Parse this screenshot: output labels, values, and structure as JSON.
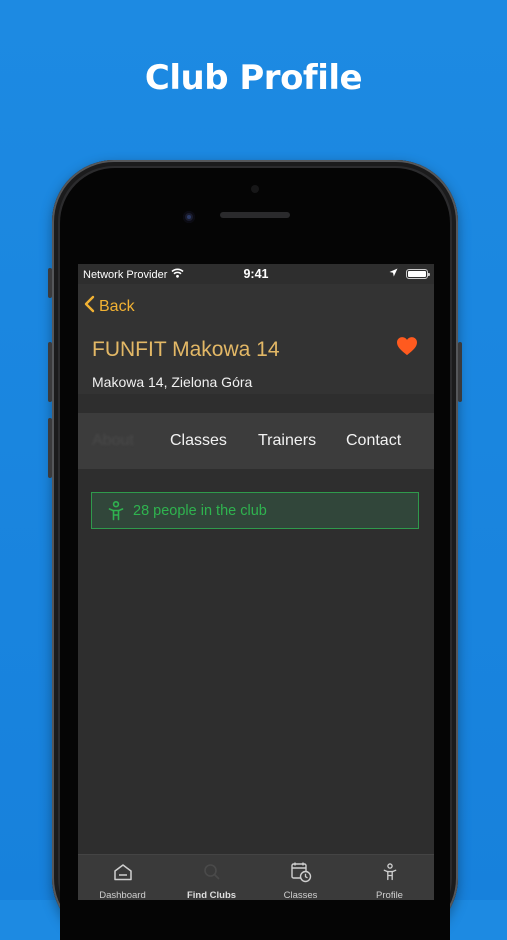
{
  "headline": "Club Profile",
  "status_bar": {
    "carrier": "Network Provider",
    "time": "9:41"
  },
  "nav": {
    "back_label": "Back"
  },
  "club": {
    "name": "FUNFIT Makowa 14",
    "address": "Makowa 14, Zielona Góra",
    "favorite": true
  },
  "tabs": [
    {
      "label": "About",
      "active": true
    },
    {
      "label": "Classes",
      "active": false
    },
    {
      "label": "Trainers",
      "active": false
    },
    {
      "label": "Contact",
      "active": false
    }
  ],
  "occupancy": {
    "text": "28 people in the club"
  },
  "tab_bar": {
    "items": [
      {
        "label": "Dashboard",
        "icon": "home-icon"
      },
      {
        "label": "Find Clubs",
        "icon": "search-icon",
        "active": true
      },
      {
        "label": "Classes",
        "icon": "calendar-clock-icon"
      },
      {
        "label": "Profile",
        "icon": "person-icon"
      }
    ]
  },
  "colors": {
    "background": "#1a86e0",
    "accent": "#f2b233",
    "heart": "#ff5a1f",
    "success": "#2fb34f",
    "screen": "#2e2e2e"
  }
}
